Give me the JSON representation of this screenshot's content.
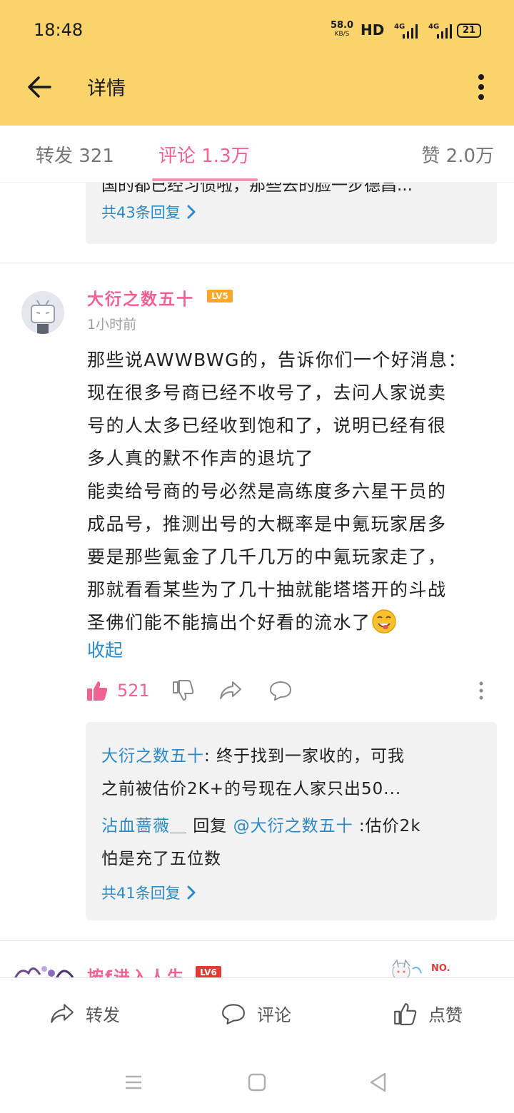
{
  "status_bar": {
    "time": "18:48",
    "net_speed": "58.0",
    "net_unit": "KB/S",
    "hd": "HD",
    "sim1": "4G",
    "sim2": "4G",
    "battery": "21"
  },
  "app_bar": {
    "title": "详情"
  },
  "tabs": [
    {
      "label": "转发 321"
    },
    {
      "label": "评论 1.3万"
    },
    {
      "label": "赞 2.0万"
    }
  ],
  "prev_reply": {
    "cut_text": "国的都已经习惯啦，那些去的脸一步德昌...",
    "more": "共43条回复"
  },
  "comment": {
    "username": "大衍之数五十",
    "level": "LV5",
    "time": "1小时前",
    "lines": [
      "那些说AWWBWG的，告诉你们一个好消息：",
      "现在很多号商已经不收号了，去问人家说卖",
      "号的人太多已经收到饱和了，说明已经有很",
      "多人真的默不作声的退坑了",
      "能卖给号商的号必然是高练度多六星干员的",
      "成品号，推测出号的大概率是中氪玩家居多",
      "要是那些氪金了几千几万的中氪玩家走了，",
      "那就看看某些为了几十抽就能塔塔开的斗战",
      "圣佛们能不能搞出个好看的流水了"
    ],
    "collapse": "收起",
    "like_count": "521"
  },
  "replies": {
    "r1_user": "大衍之数五十",
    "r1_text": ": 终于找到一家收的，可我",
    "r1_text2": "之前被估价2K+的号现在人家只出50...",
    "r2_user": "沾血蔷薇＿",
    "r2_mid": " 回复 ",
    "r2_mention": "@大衍之数五十",
    "r2_text": " :估价2k",
    "r2_text2": "怕是充了五位数",
    "more": "共41条回复"
  },
  "next_comment": {
    "username": "按f进入人生",
    "level": "LV6",
    "badge": "NO."
  },
  "bottom_bar": {
    "repost": "转发",
    "comment": "评论",
    "like": "点赞"
  },
  "colors": {
    "header": "#fbd36b",
    "accent_pink": "#f06292",
    "link_blue": "#2b8ac6"
  }
}
